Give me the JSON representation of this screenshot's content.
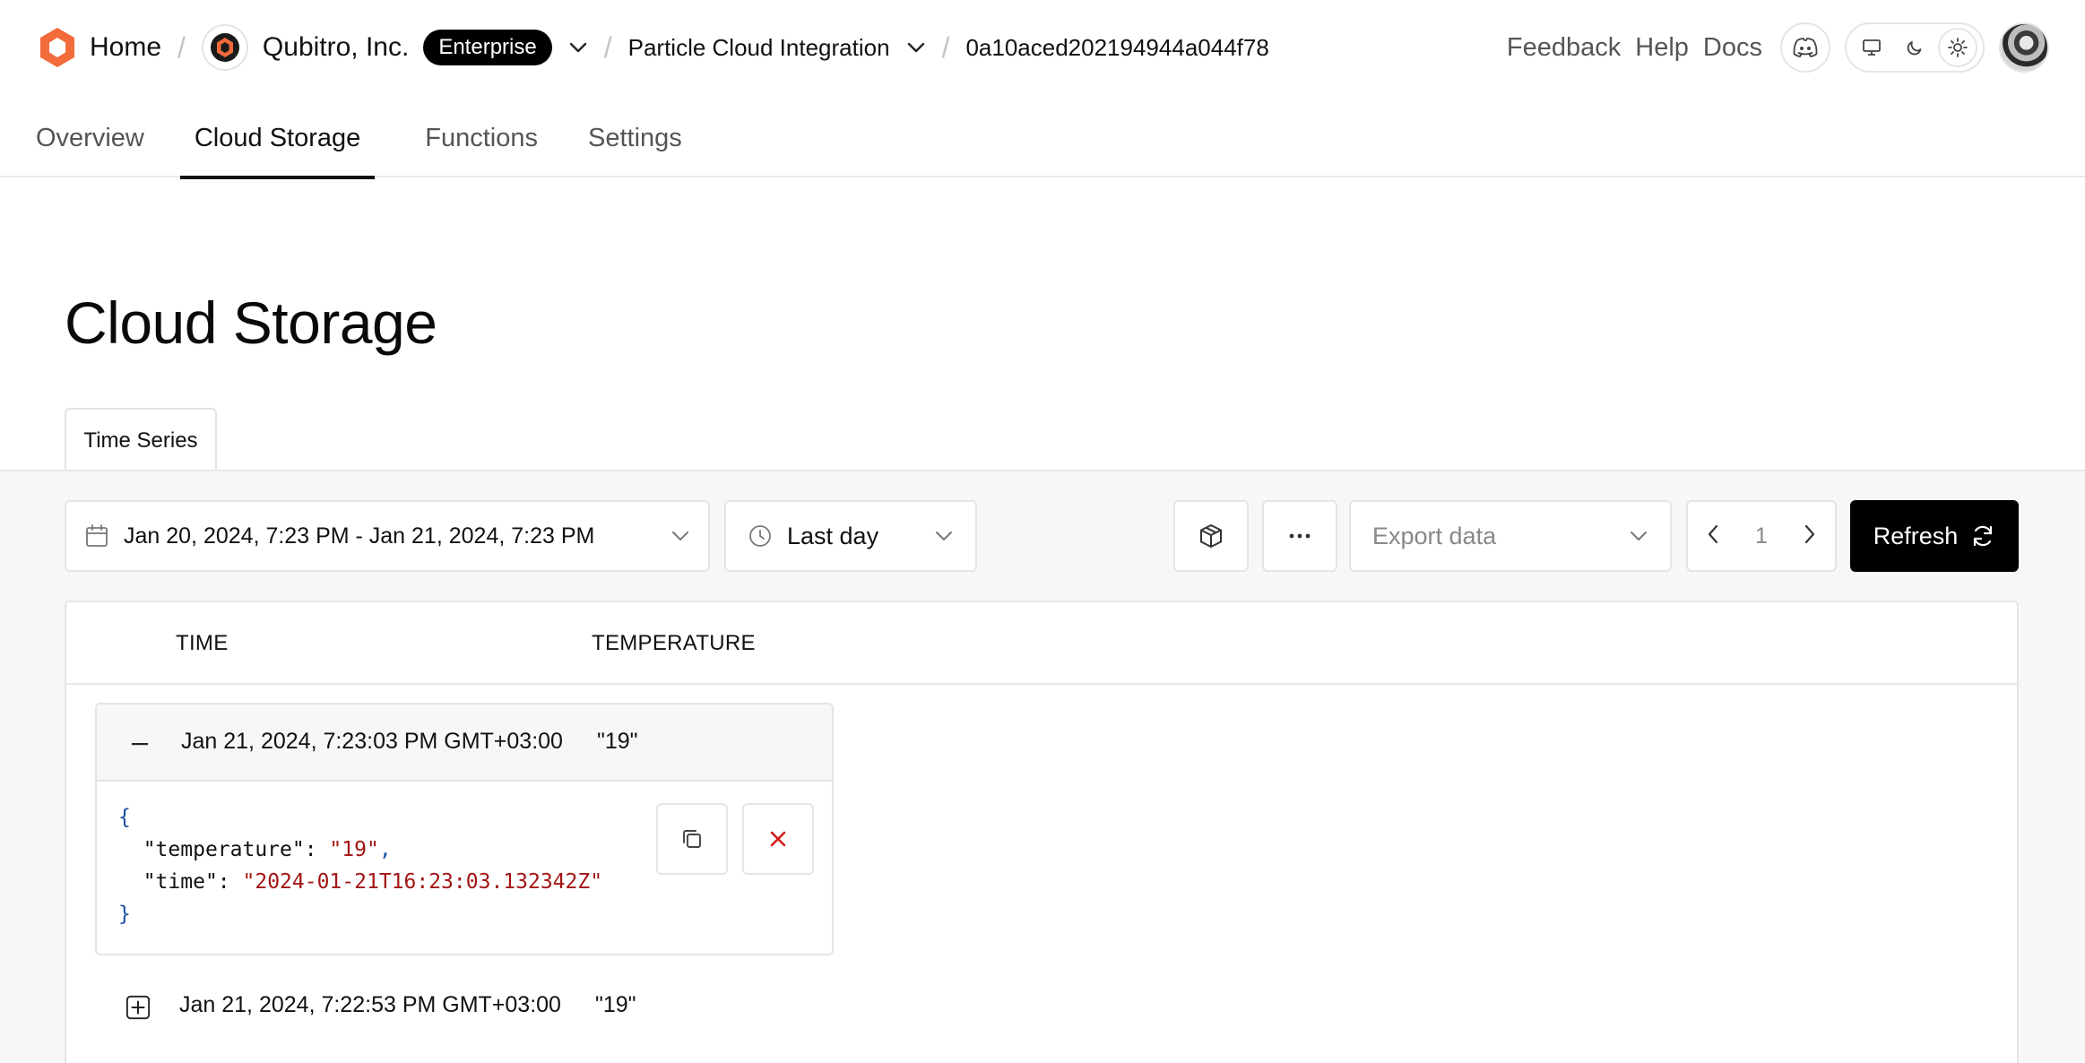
{
  "header": {
    "home_label": "Home",
    "org_name": "Qubitro, Inc.",
    "plan_badge": "Enterprise",
    "project_name": "Particle Cloud Integration",
    "device_id": "0a10aced202194944a044f78",
    "links": {
      "feedback": "Feedback",
      "help": "Help",
      "docs": "Docs"
    },
    "brand_color": "#F26B3A"
  },
  "tabs": [
    {
      "label": "Overview"
    },
    {
      "label": "Cloud Storage"
    },
    {
      "label": "Functions"
    },
    {
      "label": "Settings"
    }
  ],
  "active_tab": "Cloud Storage",
  "page_title": "Cloud Storage",
  "subtab": {
    "label": "Time Series"
  },
  "controls": {
    "date_range": "Jan 20, 2024, 7:23 PM - Jan 21, 2024, 7:23 PM",
    "preset_range": "Last day",
    "export_placeholder": "Export data",
    "page_number": "1",
    "refresh_label": "Refresh"
  },
  "table": {
    "columns": [
      "TIME",
      "TEMPERATURE"
    ],
    "rows": [
      {
        "time": "Jan 21, 2024, 7:23:03 PM GMT+03:00",
        "temperature": "\"19\"",
        "expanded": true,
        "json": {
          "open": "{",
          "temperature_key": "\"temperature\"",
          "temperature_value": "\"19\"",
          "time_key": "\"time\"",
          "time_value": "\"2024-01-21T16:23:03.132342Z\"",
          "close": "}"
        }
      },
      {
        "time": "Jan 21, 2024, 7:22:53 PM GMT+03:00",
        "temperature": "\"19\"",
        "expanded": false
      }
    ]
  }
}
